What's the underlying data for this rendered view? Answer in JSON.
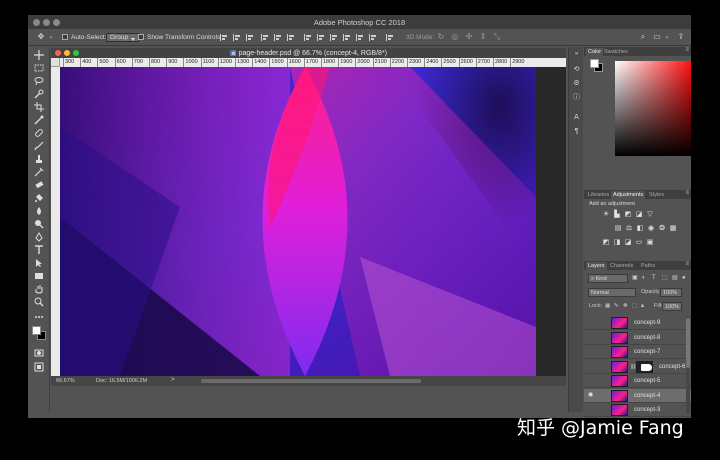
{
  "app": {
    "title": "Adobe Photoshop CC 2018"
  },
  "options_bar": {
    "auto_select_label": "Auto-Select:",
    "auto_select_value": "Group",
    "show_transform_label": "Show Transform Controls",
    "mode_3d_label": "3D Mode:"
  },
  "document": {
    "title": "page-header.psd @ 66.7% (concept-4, RGB/8*)",
    "zoom": "66.67%",
    "doc_info": "Doc: 16.5M/1006.2M",
    "status_arrow": ">",
    "ruler_ticks": [
      "300",
      "400",
      "500",
      "600",
      "700",
      "800",
      "900",
      "1000",
      "1100",
      "1200",
      "1300",
      "1400",
      "1500",
      "1600",
      "1700",
      "1800",
      "1900",
      "2000",
      "2100",
      "2200",
      "2300",
      "2400",
      "2500",
      "2600",
      "2700",
      "2800",
      "2900"
    ]
  },
  "panels": {
    "color_tabs": [
      "Color",
      "Swatches"
    ],
    "color_active": "Color",
    "adjust_tabs": [
      "Libraries",
      "Adjustments",
      "Styles"
    ],
    "adjust_active": "Adjustments",
    "add_adjustment_label": "Add an adjustment",
    "layers_tabs": [
      "Layers",
      "Channels",
      "Paths"
    ],
    "layers_active": "Layers",
    "filter_kind": "Kind",
    "blend_mode": "Normal",
    "opacity_label": "Opacity:",
    "opacity_value": "100%",
    "lock_label": "Lock:",
    "fill_label": "Fill:",
    "fill_value": "100%"
  },
  "layers": [
    {
      "name": "concept-9",
      "visible": false,
      "mask": false,
      "selected": false
    },
    {
      "name": "concept-8",
      "visible": false,
      "mask": false,
      "selected": false
    },
    {
      "name": "concept-7",
      "visible": false,
      "mask": false,
      "selected": false
    },
    {
      "name": "concept-6",
      "visible": false,
      "mask": true,
      "selected": false
    },
    {
      "name": "concept-5",
      "visible": false,
      "mask": false,
      "selected": false
    },
    {
      "name": "concept-4",
      "visible": true,
      "mask": false,
      "selected": true
    },
    {
      "name": "concept-3",
      "visible": false,
      "mask": false,
      "selected": false
    }
  ],
  "icons": {
    "footer": [
      "link-icon",
      "fx-icon",
      "mask-icon",
      "adjustment-icon",
      "folder-icon",
      "new-layer-icon",
      "trash-icon"
    ]
  },
  "colors": {
    "ui_background": "#535353",
    "canvas_pink": "#ff1f8a",
    "canvas_purple": "#6b1bd7",
    "canvas_blue": "#3a2bd8"
  },
  "watermark": "知乎 @Jamie Fang"
}
